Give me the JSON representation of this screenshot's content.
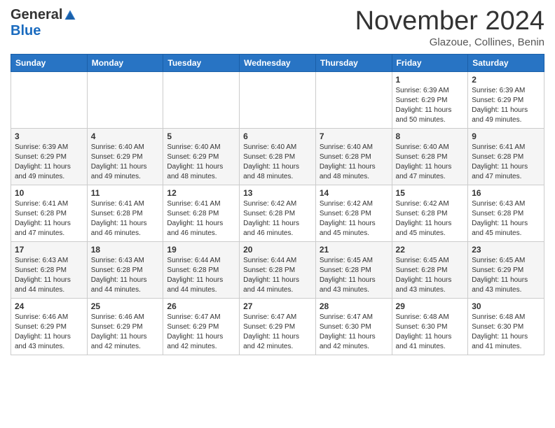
{
  "logo": {
    "general": "General",
    "blue": "Blue"
  },
  "header": {
    "month": "November 2024",
    "location": "Glazoue, Collines, Benin"
  },
  "weekdays": [
    "Sunday",
    "Monday",
    "Tuesday",
    "Wednesday",
    "Thursday",
    "Friday",
    "Saturday"
  ],
  "weeks": [
    [
      {
        "day": "",
        "info": ""
      },
      {
        "day": "",
        "info": ""
      },
      {
        "day": "",
        "info": ""
      },
      {
        "day": "",
        "info": ""
      },
      {
        "day": "",
        "info": ""
      },
      {
        "day": "1",
        "info": "Sunrise: 6:39 AM\nSunset: 6:29 PM\nDaylight: 11 hours\nand 50 minutes."
      },
      {
        "day": "2",
        "info": "Sunrise: 6:39 AM\nSunset: 6:29 PM\nDaylight: 11 hours\nand 49 minutes."
      }
    ],
    [
      {
        "day": "3",
        "info": "Sunrise: 6:39 AM\nSunset: 6:29 PM\nDaylight: 11 hours\nand 49 minutes."
      },
      {
        "day": "4",
        "info": "Sunrise: 6:40 AM\nSunset: 6:29 PM\nDaylight: 11 hours\nand 49 minutes."
      },
      {
        "day": "5",
        "info": "Sunrise: 6:40 AM\nSunset: 6:29 PM\nDaylight: 11 hours\nand 48 minutes."
      },
      {
        "day": "6",
        "info": "Sunrise: 6:40 AM\nSunset: 6:28 PM\nDaylight: 11 hours\nand 48 minutes."
      },
      {
        "day": "7",
        "info": "Sunrise: 6:40 AM\nSunset: 6:28 PM\nDaylight: 11 hours\nand 48 minutes."
      },
      {
        "day": "8",
        "info": "Sunrise: 6:40 AM\nSunset: 6:28 PM\nDaylight: 11 hours\nand 47 minutes."
      },
      {
        "day": "9",
        "info": "Sunrise: 6:41 AM\nSunset: 6:28 PM\nDaylight: 11 hours\nand 47 minutes."
      }
    ],
    [
      {
        "day": "10",
        "info": "Sunrise: 6:41 AM\nSunset: 6:28 PM\nDaylight: 11 hours\nand 47 minutes."
      },
      {
        "day": "11",
        "info": "Sunrise: 6:41 AM\nSunset: 6:28 PM\nDaylight: 11 hours\nand 46 minutes."
      },
      {
        "day": "12",
        "info": "Sunrise: 6:41 AM\nSunset: 6:28 PM\nDaylight: 11 hours\nand 46 minutes."
      },
      {
        "day": "13",
        "info": "Sunrise: 6:42 AM\nSunset: 6:28 PM\nDaylight: 11 hours\nand 46 minutes."
      },
      {
        "day": "14",
        "info": "Sunrise: 6:42 AM\nSunset: 6:28 PM\nDaylight: 11 hours\nand 45 minutes."
      },
      {
        "day": "15",
        "info": "Sunrise: 6:42 AM\nSunset: 6:28 PM\nDaylight: 11 hours\nand 45 minutes."
      },
      {
        "day": "16",
        "info": "Sunrise: 6:43 AM\nSunset: 6:28 PM\nDaylight: 11 hours\nand 45 minutes."
      }
    ],
    [
      {
        "day": "17",
        "info": "Sunrise: 6:43 AM\nSunset: 6:28 PM\nDaylight: 11 hours\nand 44 minutes."
      },
      {
        "day": "18",
        "info": "Sunrise: 6:43 AM\nSunset: 6:28 PM\nDaylight: 11 hours\nand 44 minutes."
      },
      {
        "day": "19",
        "info": "Sunrise: 6:44 AM\nSunset: 6:28 PM\nDaylight: 11 hours\nand 44 minutes."
      },
      {
        "day": "20",
        "info": "Sunrise: 6:44 AM\nSunset: 6:28 PM\nDaylight: 11 hours\nand 44 minutes."
      },
      {
        "day": "21",
        "info": "Sunrise: 6:45 AM\nSunset: 6:28 PM\nDaylight: 11 hours\nand 43 minutes."
      },
      {
        "day": "22",
        "info": "Sunrise: 6:45 AM\nSunset: 6:28 PM\nDaylight: 11 hours\nand 43 minutes."
      },
      {
        "day": "23",
        "info": "Sunrise: 6:45 AM\nSunset: 6:29 PM\nDaylight: 11 hours\nand 43 minutes."
      }
    ],
    [
      {
        "day": "24",
        "info": "Sunrise: 6:46 AM\nSunset: 6:29 PM\nDaylight: 11 hours\nand 43 minutes."
      },
      {
        "day": "25",
        "info": "Sunrise: 6:46 AM\nSunset: 6:29 PM\nDaylight: 11 hours\nand 42 minutes."
      },
      {
        "day": "26",
        "info": "Sunrise: 6:47 AM\nSunset: 6:29 PM\nDaylight: 11 hours\nand 42 minutes."
      },
      {
        "day": "27",
        "info": "Sunrise: 6:47 AM\nSunset: 6:29 PM\nDaylight: 11 hours\nand 42 minutes."
      },
      {
        "day": "28",
        "info": "Sunrise: 6:47 AM\nSunset: 6:30 PM\nDaylight: 11 hours\nand 42 minutes."
      },
      {
        "day": "29",
        "info": "Sunrise: 6:48 AM\nSunset: 6:30 PM\nDaylight: 11 hours\nand 41 minutes."
      },
      {
        "day": "30",
        "info": "Sunrise: 6:48 AM\nSunset: 6:30 PM\nDaylight: 11 hours\nand 41 minutes."
      }
    ]
  ]
}
